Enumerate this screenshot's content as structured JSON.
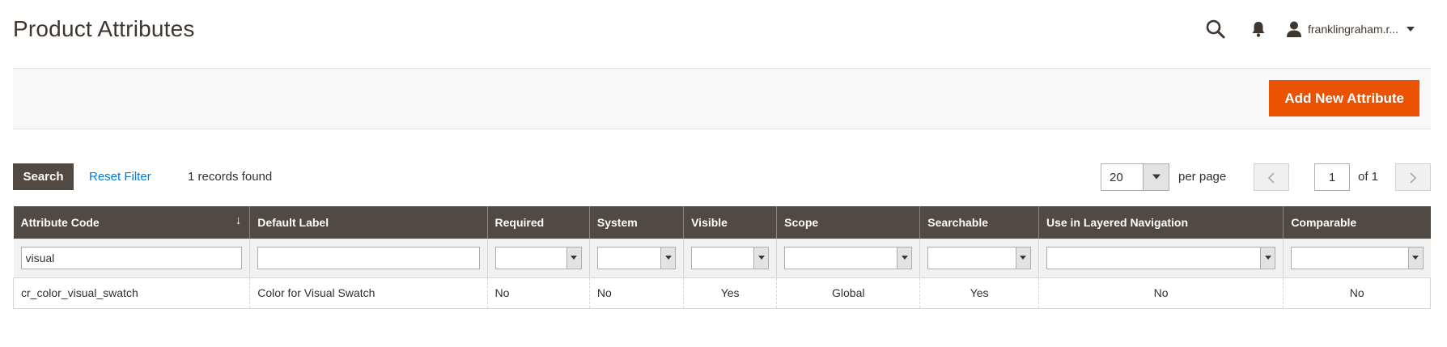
{
  "page": {
    "title": "Product Attributes"
  },
  "header": {
    "search_icon": "search-icon",
    "notifications_icon": "bell-icon",
    "user": {
      "name": "franklingraham.r...",
      "icon": "user-icon"
    }
  },
  "actions": {
    "add_new_label": "Add New Attribute"
  },
  "toolbar": {
    "search_label": "Search",
    "reset_label": "Reset Filter",
    "records_found": "1 records found",
    "per_page_value": "20",
    "per_page_label": "per page",
    "page_current": "1",
    "page_of": "of 1"
  },
  "grid": {
    "columns": [
      {
        "label": "Attribute Code",
        "sort_indicator": "↓"
      },
      {
        "label": "Default Label"
      },
      {
        "label": "Required"
      },
      {
        "label": "System"
      },
      {
        "label": "Visible"
      },
      {
        "label": "Scope"
      },
      {
        "label": "Searchable"
      },
      {
        "label": "Use in Layered Navigation"
      },
      {
        "label": "Comparable"
      }
    ],
    "filters": {
      "attribute_code": "visual",
      "default_label": ""
    },
    "rows": [
      {
        "attribute_code": "cr_color_visual_swatch",
        "default_label": "Color for Visual Swatch",
        "required": "No",
        "system": "No",
        "visible": "Yes",
        "scope": "Global",
        "searchable": "Yes",
        "layered_navigation": "No",
        "comparable": "No"
      }
    ]
  },
  "colors": {
    "accent": "#eb5202",
    "header_dark": "#514943",
    "link": "#007bdb",
    "title": "#41362f"
  }
}
